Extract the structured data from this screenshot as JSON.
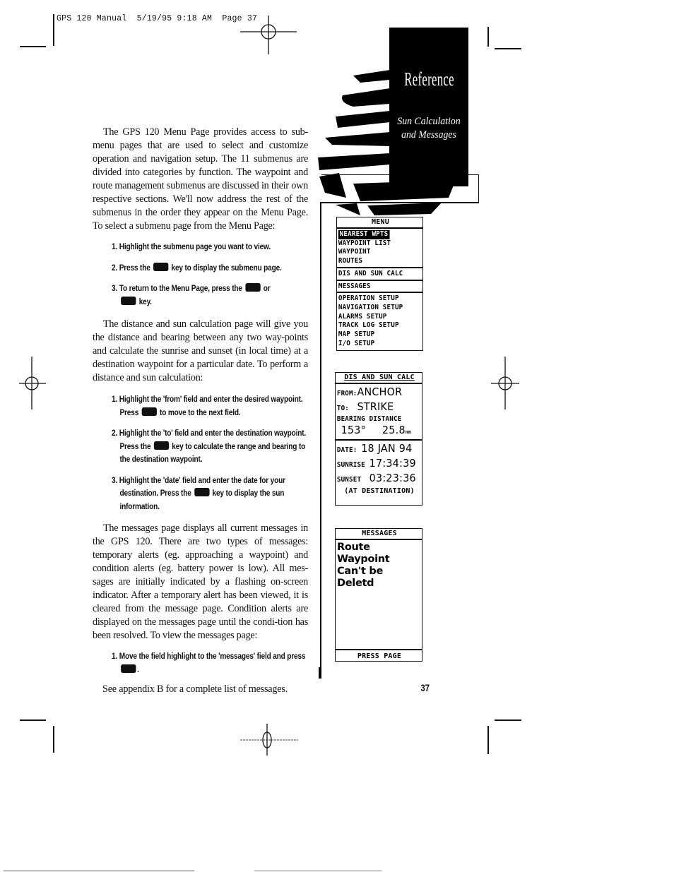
{
  "print_header": {
    "text": "GPS 120 Manual  5/19/95 9:18 AM  Page 37"
  },
  "section_tab": {
    "title": "Reference",
    "subtitle_line1": "Sun Calculation",
    "subtitle_line2": "and Messages"
  },
  "intro": {
    "paragraph": "The GPS 120 Menu Page provides access to sub-menu pages that are used to select and customize operation and navigation setup. The 11 submenus are divided into categories by function. The waypoint and route management submenus are discussed in their own respective sections. We'll now address the rest of the submenus in the order they appear on the Menu Page. To select a submenu page from the Menu Page:",
    "steps": [
      {
        "before": "1. Highlight the submenu page you want to view.",
        "after": ""
      },
      {
        "before": "2. Press the",
        "key": "ent-key",
        "after": "key to display the submenu page."
      },
      {
        "before": "3. To return to the Menu Page, press the",
        "key": "qt-key",
        "middle": "or",
        "key2": "menu-key",
        "after": "key."
      }
    ]
  },
  "distance_sun": {
    "paragraph": "The distance and sun calculation page will give you the distance and bearing between any two way-points and calculate the sunrise and sunset (in local time) at a destination waypoint for a particular date. To perform a distance and sun calculation:",
    "steps": [
      {
        "before": "1. Highlight the 'from' field and enter the desired waypoint. Press",
        "key": "ent-key",
        "after": "to move to the next field."
      },
      {
        "before": "2. Highlight the 'to' field and enter the destination waypoint. Press the",
        "key": "ent-key",
        "after": "key to calculate the range and bearing to the destination waypoint."
      },
      {
        "before": "3. Highlight the 'date' field and enter the date for your destination. Press the",
        "key": "ent-key",
        "after": "key to display the sun information."
      }
    ]
  },
  "messages": {
    "paragraph": "The messages page displays all current messages in the GPS 120. There are two types of messages: temporary alerts (eg. approaching a waypoint) and condition alerts (eg. battery power is low). All mes-sages are initially indicated by a flashing on-screen indicator. After a temporary alert has been viewed, it is cleared from the message page. Condition alerts are displayed on the messages page until the condi-tion has been resolved. To view the messages page:",
    "steps": [
      {
        "before": "1. Move the field highlight to the 'messages' field and press",
        "key": "ent-key",
        "after": "."
      }
    ],
    "footnote": "See appendix B for a complete list of messages."
  },
  "page_number": "37",
  "menu_screen": {
    "title": "MENU",
    "group1": [
      "NEAREST WPTS",
      "WAYPOINT LIST",
      "WAYPOINT",
      "ROUTES"
    ],
    "highlighted": "NEAREST WPTS",
    "group2": [
      "DIS AND SUN CALC"
    ],
    "group3": [
      "MESSAGES"
    ],
    "group4": [
      "OPERATION SETUP",
      "NAVIGATION SETUP",
      "ALARMS SETUP",
      "TRACK LOG SETUP",
      "MAP SETUP",
      "I/O SETUP"
    ]
  },
  "dis_sun_screen": {
    "title": "DIS AND SUN CALC",
    "from_label": "FROM:",
    "from_value": "ANCHOR",
    "to_label": "TO:",
    "to_value": "STRIKE",
    "bearing_label": "BEARING",
    "distance_label": "DISTANCE",
    "bearing_value": "153°",
    "distance_value": "25.8",
    "distance_unit": "nm",
    "date_label": "DATE:",
    "date_value": "18 JAN 94",
    "sunrise_label": "SUNRISE",
    "sunrise_value": "17:34:39",
    "sunset_label": "SUNSET",
    "sunset_value": "03:23:36",
    "note": "(AT DESTINATION)"
  },
  "messages_screen": {
    "title": "MESSAGES",
    "message_line1": "Route Waypoint",
    "message_line2": "Can't be Deletd",
    "footer": "PRESS PAGE"
  }
}
